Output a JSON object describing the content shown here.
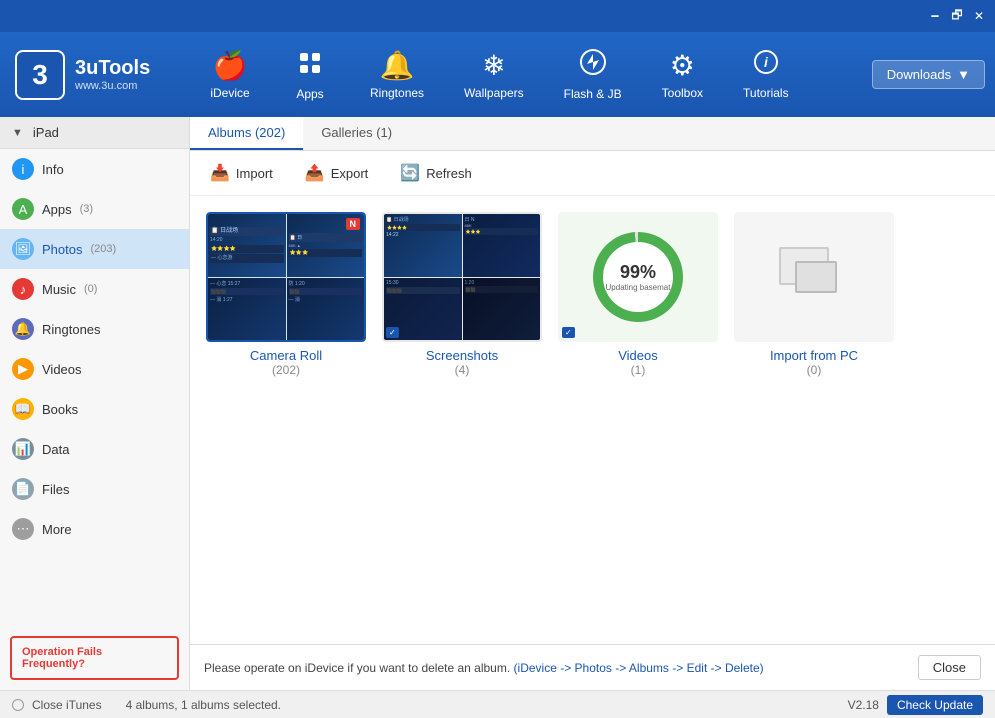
{
  "titleBar": {
    "controls": [
      "minimize",
      "maximize",
      "close"
    ],
    "icons": [
      "device-icon",
      "settings-icon"
    ]
  },
  "header": {
    "logo": {
      "symbol": "3",
      "brand": "3uTools",
      "url": "www.3u.com"
    },
    "navTabs": [
      {
        "id": "idevice",
        "icon": "🍎",
        "label": "iDevice"
      },
      {
        "id": "apps",
        "icon": "✦",
        "label": "Apps"
      },
      {
        "id": "ringtones",
        "icon": "🔔",
        "label": "Ringtones"
      },
      {
        "id": "wallpapers",
        "icon": "❄",
        "label": "Wallpapers"
      },
      {
        "id": "flash",
        "icon": "⬦",
        "label": "Flash & JB"
      },
      {
        "id": "toolbox",
        "icon": "⚙",
        "label": "Toolbox"
      },
      {
        "id": "tutorials",
        "icon": "ℹ",
        "label": "Tutorials"
      }
    ],
    "downloadsBtn": "Downloads"
  },
  "sidebar": {
    "deviceName": "iPad",
    "items": [
      {
        "id": "info",
        "label": "Info",
        "iconType": "info",
        "iconSymbol": "i",
        "badge": ""
      },
      {
        "id": "apps",
        "label": "Apps",
        "iconType": "apps",
        "iconSymbol": "A",
        "badge": "(3)"
      },
      {
        "id": "photos",
        "label": "Photos",
        "iconType": "photos",
        "iconSymbol": "🖼",
        "badge": "(203)",
        "active": true
      },
      {
        "id": "music",
        "label": "Music",
        "iconType": "music",
        "iconSymbol": "♪",
        "badge": "(0)"
      },
      {
        "id": "ringtones",
        "label": "Ringtones",
        "iconType": "ringtones",
        "iconSymbol": "🔔",
        "badge": ""
      },
      {
        "id": "videos",
        "label": "Videos",
        "iconType": "videos",
        "iconSymbol": "▶",
        "badge": ""
      },
      {
        "id": "books",
        "label": "Books",
        "iconType": "books",
        "iconSymbol": "📖",
        "badge": ""
      },
      {
        "id": "data",
        "label": "Data",
        "iconType": "data",
        "iconSymbol": "📊",
        "badge": ""
      },
      {
        "id": "files",
        "label": "Files",
        "iconType": "files",
        "iconSymbol": "📄",
        "badge": ""
      },
      {
        "id": "more",
        "label": "More",
        "iconType": "more",
        "iconSymbol": "⋯",
        "badge": ""
      }
    ],
    "opFailsBtn": "Operation Fails Frequently?"
  },
  "contentTabs": [
    {
      "id": "albums",
      "label": "Albums (202)",
      "active": true
    },
    {
      "id": "galleries",
      "label": "Galleries (1)",
      "active": false
    }
  ],
  "toolbar": {
    "importBtn": "Import",
    "exportBtn": "Export",
    "refreshBtn": "Refresh"
  },
  "albums": [
    {
      "id": "camera-roll",
      "name": "Camera Roll",
      "count": "(202)",
      "selected": true,
      "type": "game"
    },
    {
      "id": "screenshots",
      "name": "Screenshots",
      "count": "(4)",
      "selected": false,
      "type": "screenshots"
    },
    {
      "id": "videos",
      "name": "Videos",
      "count": "(1)",
      "selected": false,
      "type": "progress"
    },
    {
      "id": "import-pc",
      "name": "Import from PC",
      "count": "(0)",
      "selected": false,
      "type": "import"
    }
  ],
  "progressCircle": {
    "pct": "99%",
    "text": "Updating basemat"
  },
  "infoBar": {
    "message": "Please operate on iDevice if you want to delete an album.",
    "link": "(iDevice -> Photos -> Albums -> Edit -> Delete)",
    "closeBtn": "Close"
  },
  "statusBar": {
    "itunes": "Close iTunes",
    "version": "V2.18",
    "checkUpdate": "Check Update",
    "albumsInfo": "4 albums, 1 albums selected."
  }
}
